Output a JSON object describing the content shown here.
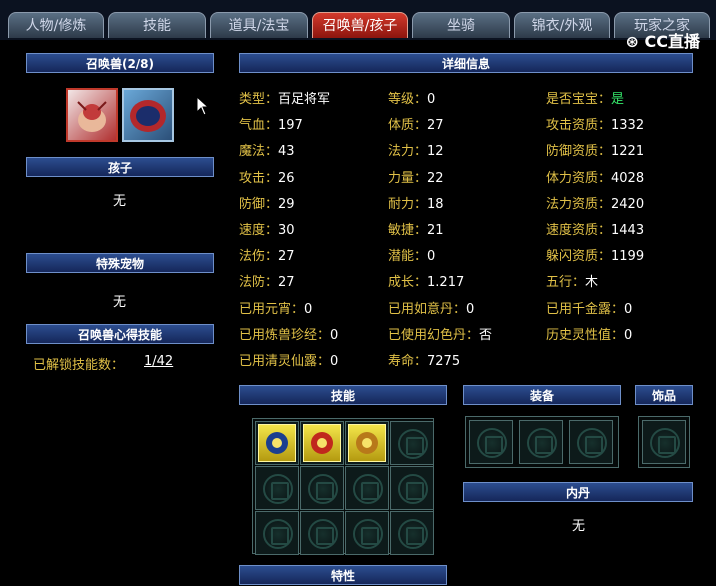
{
  "tabs": [
    "人物/修炼",
    "技能",
    "道具/法宝",
    "召唤兽/孩子",
    "坐骑",
    "锦衣/外观",
    "玩家之家"
  ],
  "active_tab": 3,
  "logo": "CC直播",
  "left": {
    "pet_header": "召唤兽(2/8)",
    "child_header": "孩子",
    "child_value": "无",
    "special_header": "特殊宠物",
    "special_value": "无",
    "skill_header": "召唤兽心得技能",
    "unlocked_label": "已解锁技能数：",
    "unlocked_value": "1/42"
  },
  "detail": {
    "header": "详细信息",
    "col1": [
      {
        "label": "类型：",
        "value": "百足将军"
      },
      {
        "label": "气血：",
        "value": "197"
      },
      {
        "label": "魔法：",
        "value": "43"
      },
      {
        "label": "攻击：",
        "value": "26"
      },
      {
        "label": "防御：",
        "value": "29"
      },
      {
        "label": "速度：",
        "value": "30"
      },
      {
        "label": "法伤：",
        "value": "27"
      },
      {
        "label": "法防：",
        "value": "27"
      },
      {
        "label": "已用元宵：",
        "value": "0"
      },
      {
        "label": "已用炼兽珍经：",
        "value": "0"
      },
      {
        "label": "已用清灵仙露：",
        "value": "0"
      }
    ],
    "col2": [
      {
        "label": "等级：",
        "value": "0"
      },
      {
        "label": "体质：",
        "value": "27"
      },
      {
        "label": "法力：",
        "value": "12"
      },
      {
        "label": "力量：",
        "value": "22"
      },
      {
        "label": "耐力：",
        "value": "18"
      },
      {
        "label": "敏捷：",
        "value": "21"
      },
      {
        "label": "潜能：",
        "value": "0"
      },
      {
        "label": "成长：",
        "value": "1.217"
      },
      {
        "label": "已用如意丹：",
        "value": "0"
      },
      {
        "label": "已使用幻色丹：",
        "value": "否"
      },
      {
        "label": "寿命：",
        "value": "7275"
      }
    ],
    "col3": [
      {
        "label": "是否宝宝：",
        "value": "是"
      },
      {
        "label": "攻击资质：",
        "value": "1332"
      },
      {
        "label": "防御资质：",
        "value": "1221"
      },
      {
        "label": "体力资质：",
        "value": "4028"
      },
      {
        "label": "法力资质：",
        "value": "2420"
      },
      {
        "label": "速度资质：",
        "value": "1443"
      },
      {
        "label": "躲闪资质：",
        "value": "1199"
      },
      {
        "label": "五行：",
        "value": "木"
      },
      {
        "label": "已用千金露：",
        "value": "0"
      },
      {
        "label": "历史灵性值：",
        "value": "0"
      }
    ]
  },
  "skills_header": "技能",
  "equip_header": "装备",
  "accessory_header": "饰品",
  "neidan_header": "内丹",
  "neidan_value": "无",
  "trait_header": "特性",
  "colors": {
    "label": "#e0c047",
    "green": "#35e86a",
    "header_bg": "#1f3a77",
    "active_tab": "#c02a1e"
  }
}
